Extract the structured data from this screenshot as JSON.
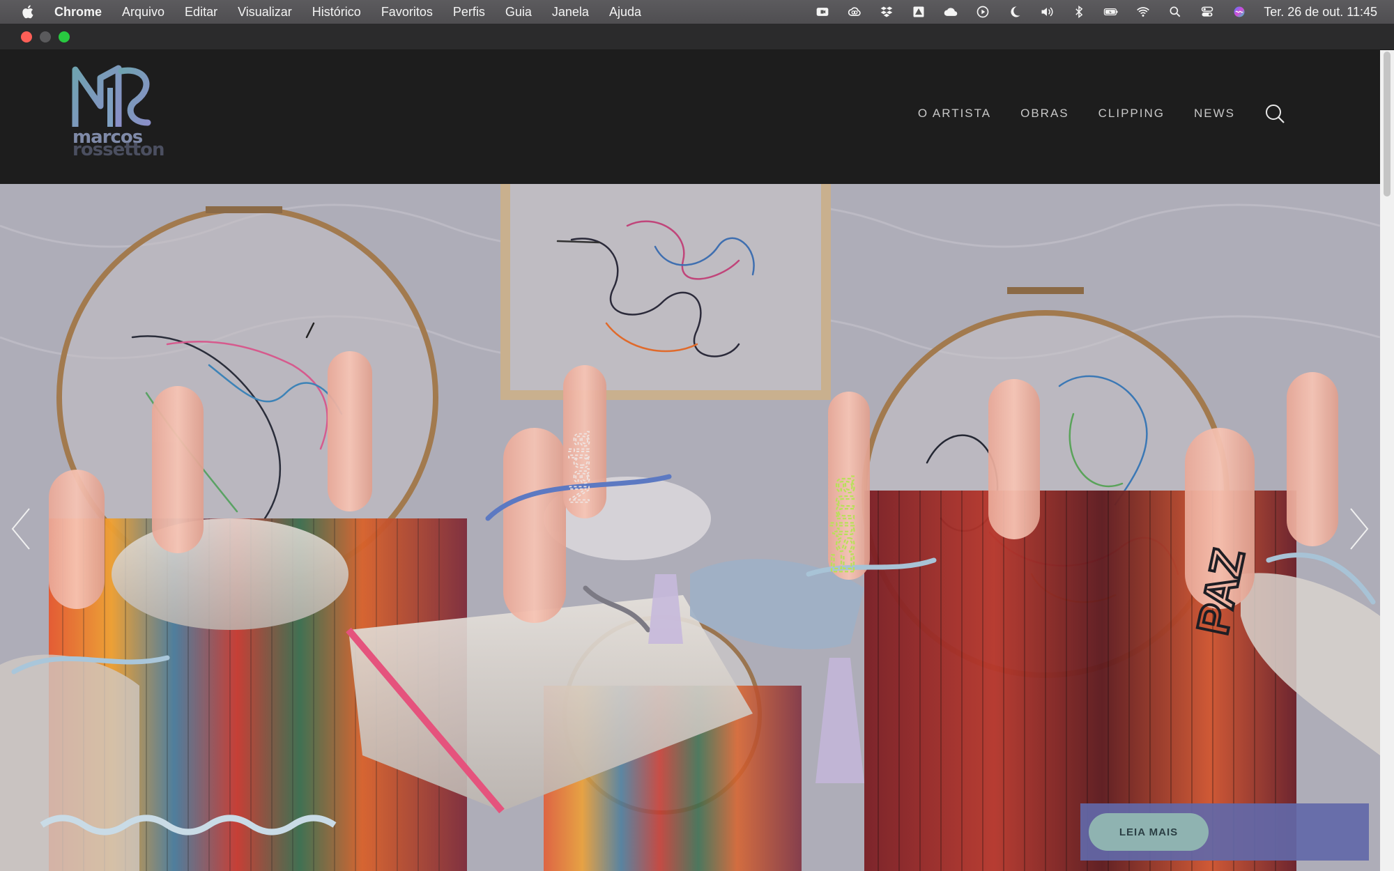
{
  "menubar": {
    "app_name": "Chrome",
    "items": [
      "Arquivo",
      "Editar",
      "Visualizar",
      "Histórico",
      "Favoritos",
      "Perfis",
      "Guia",
      "Janela",
      "Ajuda"
    ],
    "status_icons": [
      "video-camera-icon",
      "creative-cloud-icon",
      "dropbox-icon",
      "drive-icon",
      "cloud-icon",
      "play-icon",
      "moon-icon",
      "volume-icon",
      "bluetooth-icon",
      "battery-icon",
      "wifi-icon",
      "spotlight-search-icon",
      "control-center-icon",
      "siri-icon"
    ],
    "clock": "Ter. 26 de out.  11:45"
  },
  "site": {
    "logo_line1": "marcos",
    "logo_line2": "rossetton",
    "nav": [
      "O ARTISTA",
      "OBRAS",
      "CLIPPING",
      "NEWS"
    ]
  },
  "hero": {
    "cta_label": "LEIA MAIS",
    "words": [
      "Nadia",
      "Estima",
      "PAZ"
    ]
  }
}
